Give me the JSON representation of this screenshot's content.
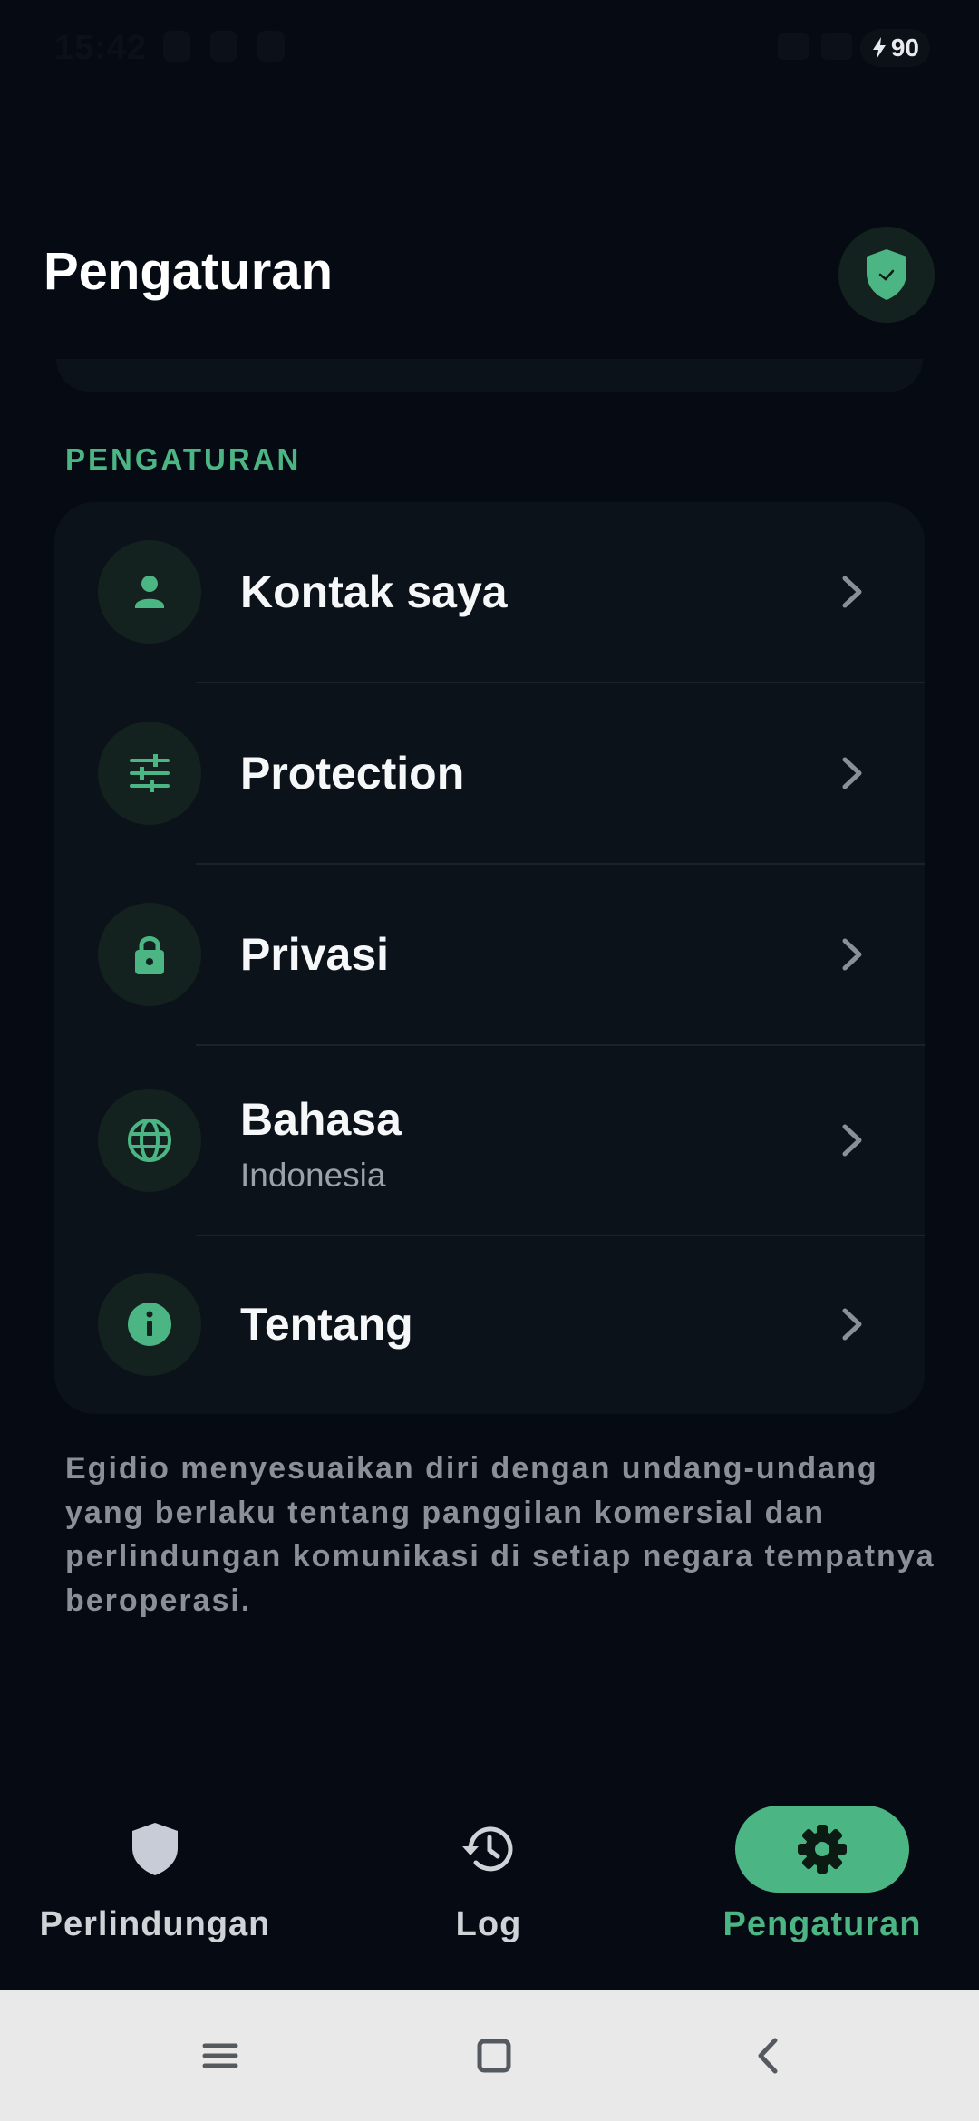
{
  "status_bar": {
    "time": "15:42",
    "battery_level": "90"
  },
  "header": {
    "title": "Pengaturan",
    "badge_icon": "shield-check-icon"
  },
  "settings": {
    "section_label": "PENGATURAN",
    "items": [
      {
        "label": "Kontak saya",
        "icon": "person-icon"
      },
      {
        "label": "Protection",
        "icon": "sliders-icon"
      },
      {
        "label": "Privasi",
        "icon": "lock-icon"
      },
      {
        "label": "Bahasa",
        "subtitle": "Indonesia",
        "icon": "globe-icon"
      },
      {
        "label": "Tentang",
        "icon": "info-icon"
      }
    ],
    "footnote": "Egidio menyesuaikan diri dengan undang-undang yang berlaku tentang panggilan komersial dan perlindungan komunikasi di setiap negara tempatnya beroperasi."
  },
  "bottom_nav": {
    "items": [
      {
        "label": "Perlindungan",
        "icon": "shield-icon",
        "active": false
      },
      {
        "label": "Log",
        "icon": "history-icon",
        "active": false
      },
      {
        "label": "Pengaturan",
        "icon": "gear-icon",
        "active": true
      }
    ]
  },
  "colors": {
    "background": "#060b13",
    "card": "#0b1219",
    "accent": "#4cb584",
    "icon_circle": "#13221e"
  }
}
